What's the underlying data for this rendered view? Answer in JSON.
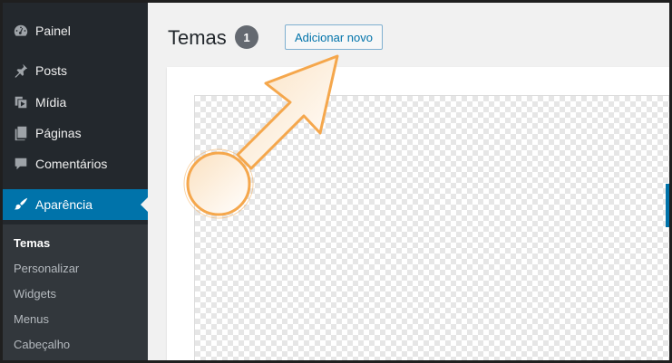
{
  "sidebar": {
    "items": [
      {
        "label": "Painel",
        "icon": "dashboard-icon"
      },
      {
        "label": "Posts",
        "icon": "pin-icon"
      },
      {
        "label": "Mídia",
        "icon": "media-icon"
      },
      {
        "label": "Páginas",
        "icon": "pages-icon"
      },
      {
        "label": "Comentários",
        "icon": "comments-icon"
      },
      {
        "label": "Aparência",
        "icon": "brush-icon",
        "active": true
      }
    ],
    "submenu": [
      {
        "label": "Temas",
        "current": true
      },
      {
        "label": "Personalizar"
      },
      {
        "label": "Widgets"
      },
      {
        "label": "Menus"
      },
      {
        "label": "Cabeçalho"
      }
    ]
  },
  "main": {
    "title": "Temas",
    "count": "1",
    "add_new_label": "Adicionar novo"
  },
  "colors": {
    "sidebar_bg": "#23282d",
    "active_blue": "#0073aa",
    "annotation_orange": "#f5a74c"
  }
}
